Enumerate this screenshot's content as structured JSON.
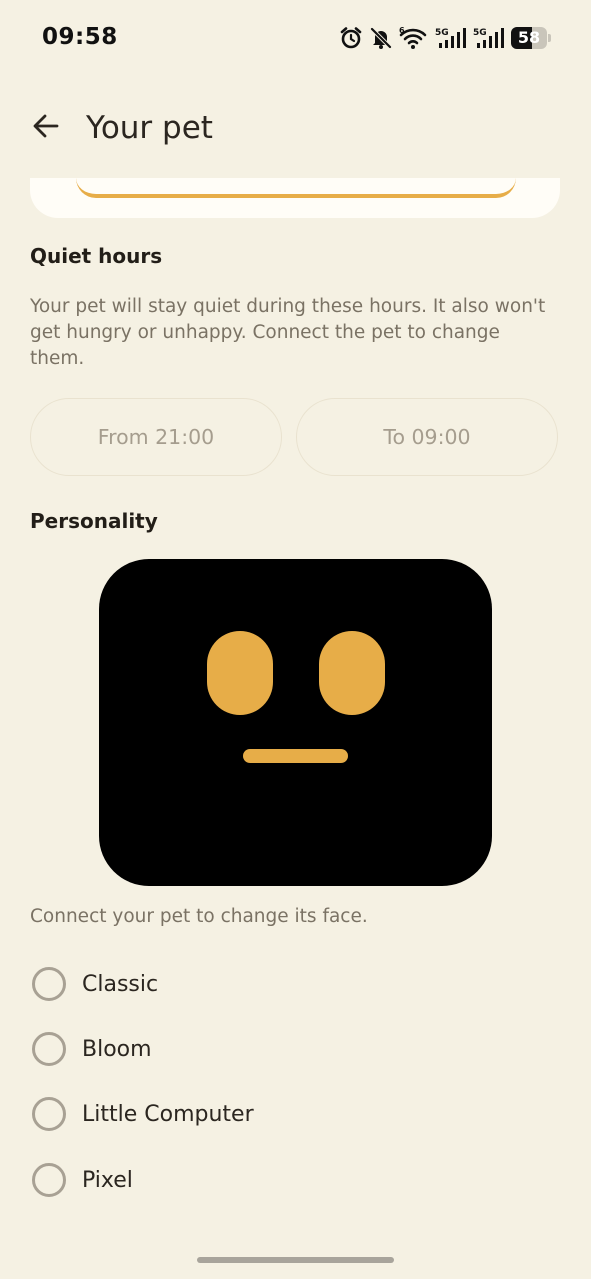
{
  "status_bar": {
    "time": "09:58",
    "icons": [
      "alarm-icon",
      "bell-off-icon",
      "wifi-6-icon",
      "signal-5g-icon",
      "signal-5g-icon"
    ],
    "network_label_1": "5G",
    "network_label_2": "5G",
    "wifi_badge": "6",
    "battery_percent": "58",
    "battery_level": 0.58
  },
  "app_bar": {
    "back_icon": "arrow-left-icon",
    "title": "Your pet"
  },
  "quiet_hours": {
    "heading": "Quiet hours",
    "description": "Your pet will stay quiet during these hours. It also won't get hungry or unhappy. Connect the pet to change them.",
    "from_label": "From 21:00",
    "to_label": "To 09:00"
  },
  "personality": {
    "heading": "Personality",
    "face_hint": "Connect your pet to change its face.",
    "options": [
      {
        "label": "Classic",
        "selected": false
      },
      {
        "label": "Bloom",
        "selected": false
      },
      {
        "label": "Little Computer",
        "selected": false
      },
      {
        "label": "Pixel",
        "selected": false
      }
    ]
  },
  "colors": {
    "background": "#f5f1e3",
    "accent": "#e7ad48",
    "face_bg": "#000000",
    "muted_text": "#7a7264"
  }
}
